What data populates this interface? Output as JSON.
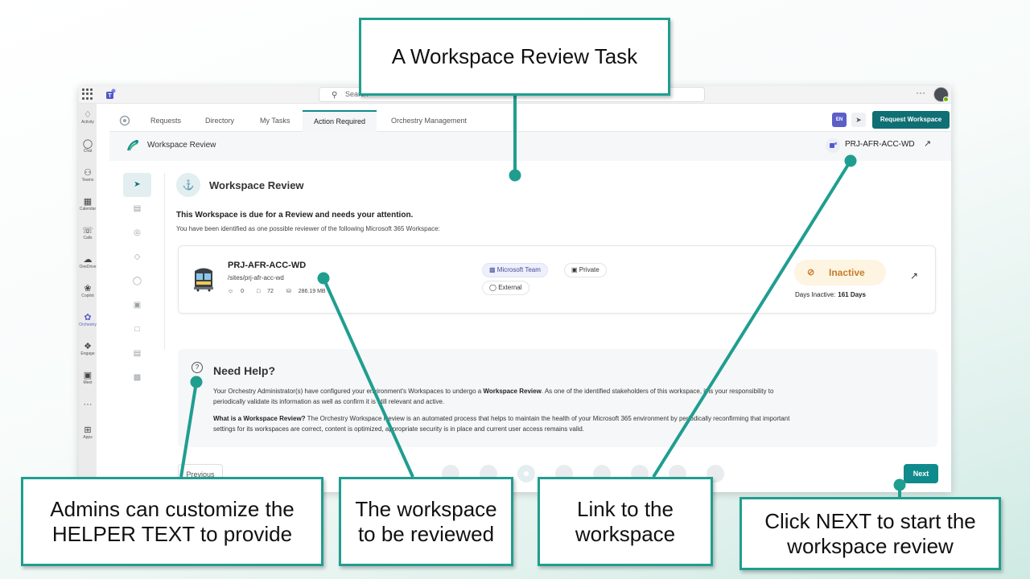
{
  "titlebar": {
    "search_placeholder": "Search"
  },
  "rail": {
    "items": [
      {
        "label": "Activity",
        "icon": "bell-icon"
      },
      {
        "label": "Chat",
        "icon": "chat-icon"
      },
      {
        "label": "Teams",
        "icon": "teams-icon"
      },
      {
        "label": "Calendar",
        "icon": "calendar-icon"
      },
      {
        "label": "Calls",
        "icon": "phone-icon"
      },
      {
        "label": "OneDrive",
        "icon": "cloud-icon"
      },
      {
        "label": "Copilot",
        "icon": "copilot-icon"
      },
      {
        "label": "Orchestry",
        "icon": "orchestry-icon"
      },
      {
        "label": "Engage",
        "icon": "engage-icon"
      },
      {
        "label": "Meet",
        "icon": "video-icon"
      },
      {
        "label": "Apps",
        "icon": "plus-icon"
      }
    ]
  },
  "tabs": [
    "Requests",
    "Directory",
    "My Tasks",
    "Action Required",
    "Orchestry Management"
  ],
  "toolbar": {
    "lang": "EN",
    "request_workspace": "Request Workspace"
  },
  "page_header": {
    "title": "Workspace Review",
    "workspace_link": "PRJ-AFR-ACC-WD"
  },
  "review": {
    "title": "Workspace Review",
    "due_text": "This Workspace is due for a Review and needs your attention.",
    "identified_text": "You have been identified as one possible reviewer of the following Microsoft 365 Workspace:"
  },
  "workspace": {
    "name": "PRJ-AFR-ACC-WD",
    "path": "/sites/prj-afr-acc-wd",
    "members": "0",
    "files": "72",
    "storage": "286.19 MB",
    "badges": {
      "type": "Microsoft Team",
      "privacy": "Private",
      "sharing": "External"
    },
    "status": "Inactive",
    "days_inactive_label": "Days Inactive:",
    "days_inactive_value": "161 Days"
  },
  "help": {
    "title": "Need Help?",
    "p1_a": "Your Orchestry Administrator(s) have configured your environment's Workspaces to undergo a ",
    "p1_b": "Workspace Review",
    "p1_c": ". As one of the identified stakeholders of this workspace, it is your responsibility to",
    "p1_d": "periodically validate its information as well as confirm it is still relevant and active.",
    "p2_a": "What is a Workspace Review?",
    "p2_b": " The Orchestry Workspace Review is an automated process that helps to maintain the health of your Microsoft 365 environment by periodically reconfirming that important",
    "p2_c": "settings for its workspaces are correct, content is optimized, appropriate security is in place and current user access remains valid."
  },
  "footer": {
    "previous": "Previous",
    "next": "Next"
  },
  "annotations": {
    "top": "A Workspace Review Task",
    "helper_l1": "Admins can customize the",
    "helper_l2": "HELPER TEXT to provide",
    "ws_l1": "The workspace",
    "ws_l2": "to be reviewed",
    "link_l1": "Link to the",
    "link_l2": "workspace",
    "next_l1": "Click NEXT to start the",
    "next_l2": "workspace review"
  },
  "colors": {
    "accent": "#0f8b8d",
    "callout_border": "#1f9e90",
    "inactive": "#c77b2c",
    "teams_purple": "#5b5fc7"
  }
}
